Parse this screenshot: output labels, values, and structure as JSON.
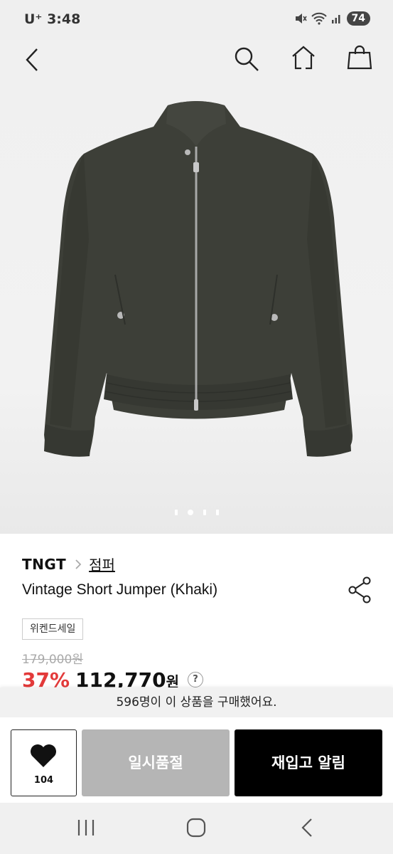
{
  "status_bar": {
    "carrier": "U⁺ 3:48",
    "battery": "74"
  },
  "nav": {
    "icons": [
      "back-icon",
      "search-icon",
      "home-icon",
      "shopping-bag-icon"
    ]
  },
  "product": {
    "brand": "TNGT",
    "category": "점퍼",
    "name": "Vintage Short Jumper (Khaki)",
    "tag": "위켄드세일",
    "original_price": "179,000원",
    "discount": "37%",
    "price": "112,770",
    "currency": "원",
    "help": "?",
    "image_count": 4,
    "image_index": 1,
    "jacket_color": "#3d3f38"
  },
  "banner": {
    "text": "596명이 이 상품을 구매했어요."
  },
  "actions": {
    "like_count": "104",
    "soldout_label": "일시품절",
    "restock_label": "재입고 알림"
  }
}
